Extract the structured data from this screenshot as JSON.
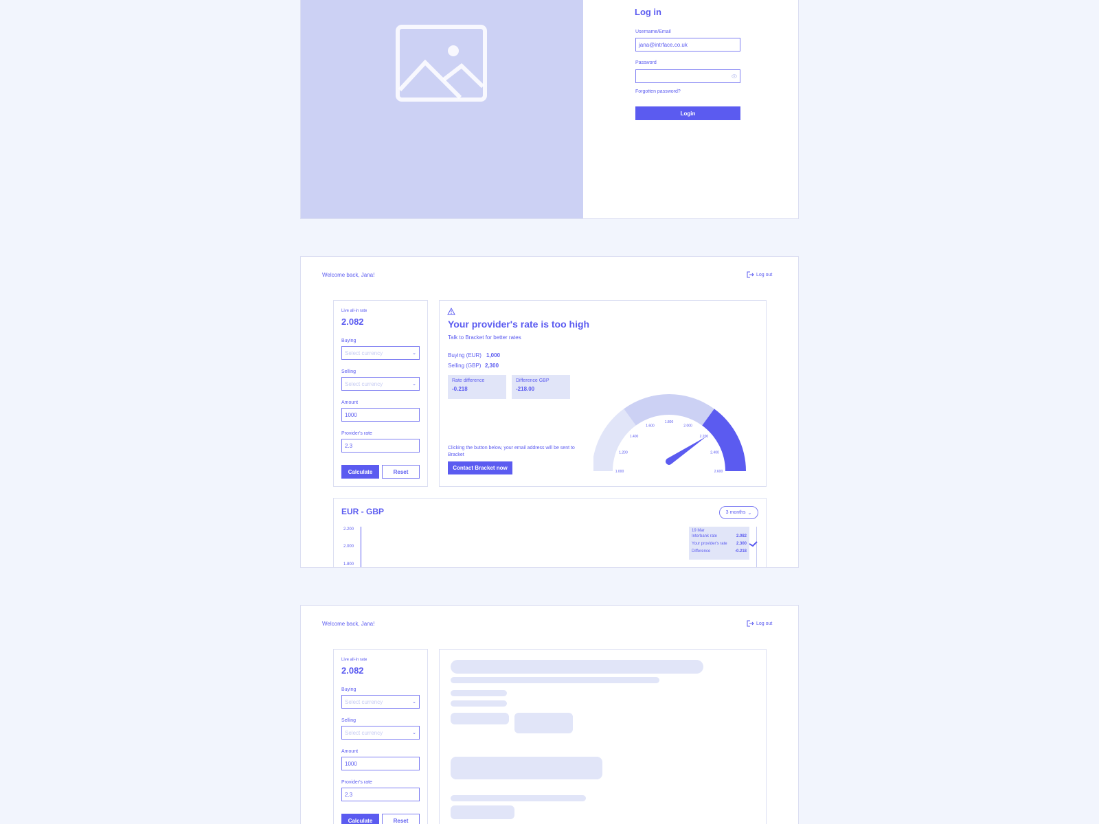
{
  "login": {
    "title": "Log in",
    "username_label": "Username/Email",
    "username_value": "jana@intrface.co.uk",
    "password_label": "Password",
    "forgot_label": "Forgotten password?",
    "login_button": "Login"
  },
  "dashboard": {
    "welcome": "Welcome back, Jana!",
    "logout": "Log out",
    "sidebar": {
      "live_label": "Live all-in rate",
      "live_value": "2.082",
      "buying_label": "Buying",
      "buying_placeholder": "Select currency",
      "selling_label": "Selling",
      "selling_placeholder": "Select currency",
      "amount_label": "Amount",
      "amount_value": "1000",
      "provider_label": "Provider's rate",
      "provider_value": "2.3",
      "calculate_button": "Calculate",
      "reset_button": "Reset"
    },
    "alert": {
      "title": "Your provider's rate is too high",
      "subtitle": "Talk to Bracket for better rates",
      "buying_label": "Buying (EUR)",
      "buying_value": "1,000",
      "selling_label": "Selling (GBP)",
      "selling_value": "2,300",
      "rate_diff_label": "Rate difference",
      "rate_diff_value": "-0.218",
      "diff_gbp_label": "Difference GBP",
      "diff_gbp_value": "-218.00",
      "note": "Clicking the button below, your email address will be sent to Bracket",
      "contact_button": "Contact Bracket now"
    },
    "gauge": {
      "ticks": [
        "1.000",
        "1.200",
        "1.400",
        "1.600",
        "1.800",
        "2.000",
        "2.200",
        "2.400",
        "2.600"
      ],
      "value": 2.3,
      "min": 1.0,
      "max": 2.6,
      "colors": {
        "low": "#e1e5f8",
        "mid": "#ccd1f4",
        "high": "#5b5bf0"
      }
    },
    "chart": {
      "title": "EUR - GBP",
      "range_button": "3 months",
      "y_ticks": [
        "2.200",
        "2.000",
        "1.800"
      ],
      "tooltip": {
        "date": "19 Mar",
        "rows": [
          {
            "label": "Interbank rate",
            "value": "2.082"
          },
          {
            "label": "Your provider's rate",
            "value": "2.300"
          },
          {
            "label": "Difference",
            "value": "-0.218"
          }
        ]
      }
    }
  },
  "accent": "#5b5bf0"
}
